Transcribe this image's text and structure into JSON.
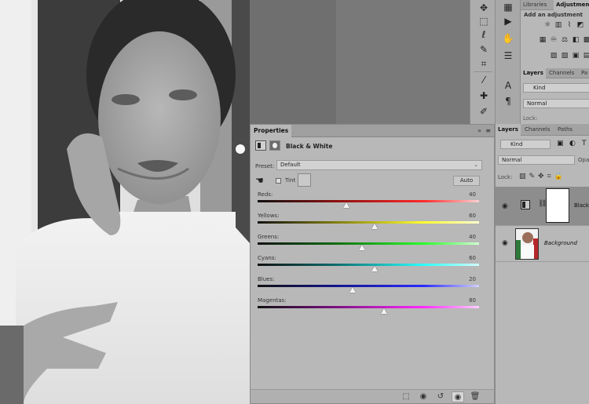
{
  "toolbar": {
    "tools": [
      "move-tool",
      "marquee-tool",
      "lasso-tool",
      "quick-select-tool",
      "crop-tool",
      "eyedropper-tool",
      "healing-brush-tool",
      "brush-tool"
    ]
  },
  "top_panel": {
    "tabs": [
      "Libraries",
      "Adjustments"
    ],
    "add_adjustment_label": "Add an adjustment"
  },
  "mini_layers": {
    "tabs": [
      "Layers",
      "Channels",
      "Pa"
    ],
    "kind_label": "Kind",
    "blend_mode": "Normal",
    "lock_label": "Lock:"
  },
  "properties": {
    "tab_label": "Properties",
    "collapse_label": "»",
    "menu_label": "≡",
    "adjustment_title": "Black & White",
    "preset_label": "Preset:",
    "preset_value": "Default",
    "tint_label": "Tint",
    "auto_label": "Auto",
    "sliders": [
      {
        "label": "Reds:",
        "value": "40",
        "pos": 0.4
      },
      {
        "label": "Yellows:",
        "value": "60",
        "pos": 0.53
      },
      {
        "label": "Greens:",
        "value": "40",
        "pos": 0.47
      },
      {
        "label": "Cyans:",
        "value": "60",
        "pos": 0.53
      },
      {
        "label": "Blues:",
        "value": "20",
        "pos": 0.43
      },
      {
        "label": "Magentas:",
        "value": "80",
        "pos": 0.57
      }
    ]
  },
  "layers": {
    "tabs": [
      "Layers",
      "Channels",
      "Paths"
    ],
    "kind_label": "Kind",
    "blend_mode": "Normal",
    "opacity_label": "Opa",
    "lock_label": "Lock:",
    "items": [
      {
        "name": "Black",
        "type": "adjustment"
      },
      {
        "name": "Background",
        "type": "image"
      }
    ]
  },
  "colors": {
    "ui_bg": "#b8b8b8",
    "workspace": "#535353"
  }
}
